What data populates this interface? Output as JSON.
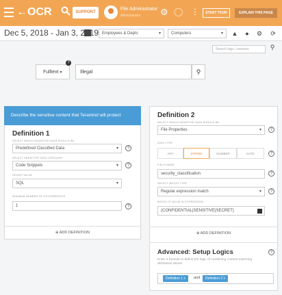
{
  "topbar": {
    "app_title": "OCR",
    "support_label": "SUPPORT",
    "user_name": "File Administrator",
    "user_role": "Administrator",
    "start_tour_label": "START TOUR",
    "explain_label": "EXPLAIN THIS PAGE"
  },
  "filters": {
    "date_range": "Dec 5, 2018 - Jan 3, 2019",
    "employees_select": "Employees & Depts",
    "computers_select": "Computers",
    "tag_search_placeholder": "Search tags / reasons"
  },
  "fulltext": {
    "mode": "Fulltext",
    "query": "Illegal"
  },
  "left_card": {
    "banner": "Describe the sensitive content that Teramind will protect",
    "title": "Definition 1",
    "type_label": "SELECT WHICH SENSITIVE DATA SHOULD BE",
    "type_value": "Predefined Classified Data",
    "sub_label": "SELECT SENSITIVE DATA CATEGORY",
    "sub_value": "Code Snippets",
    "group_label": "GROUP VALUE",
    "group_value": "SQL",
    "threshold_label": "MINIMUM NUMBER OF OCCURRENCES",
    "threshold_value": "1",
    "add_definition": "ADD DEFINITION"
  },
  "right_card": {
    "title": "Definition 2",
    "type_label": "SELECT WHICH SENSITIVE DATA SHOULD BE",
    "type_value": "File Properties",
    "data_type_label": "DATA TYPE",
    "tabs": [
      "ANY",
      "STRING",
      "NUMBER",
      "DATE"
    ],
    "active_tab": 1,
    "field_label": "FIELD NAME",
    "field_value": "security_classification",
    "match_label": "SELECT MATCH TYPE",
    "match_value": "Regular expression match",
    "expr_label": "MATCH IF VALUE IN EXPRESSION",
    "expr_value": "(CONFIDENTIAL|SENSITIVE|SECRET)",
    "add_definition": "ADD DEFINITION",
    "logic_title": "Advanced: Setup Logics",
    "logic_help": "Enter a formula to define the logic of combining content matching definitions above.",
    "chip1": "Definition 1 x",
    "chip_join": "and",
    "chip2": "Definition 2 x"
  },
  "colors": {
    "accent": "#f2a654",
    "banner": "#4a9cd6"
  }
}
